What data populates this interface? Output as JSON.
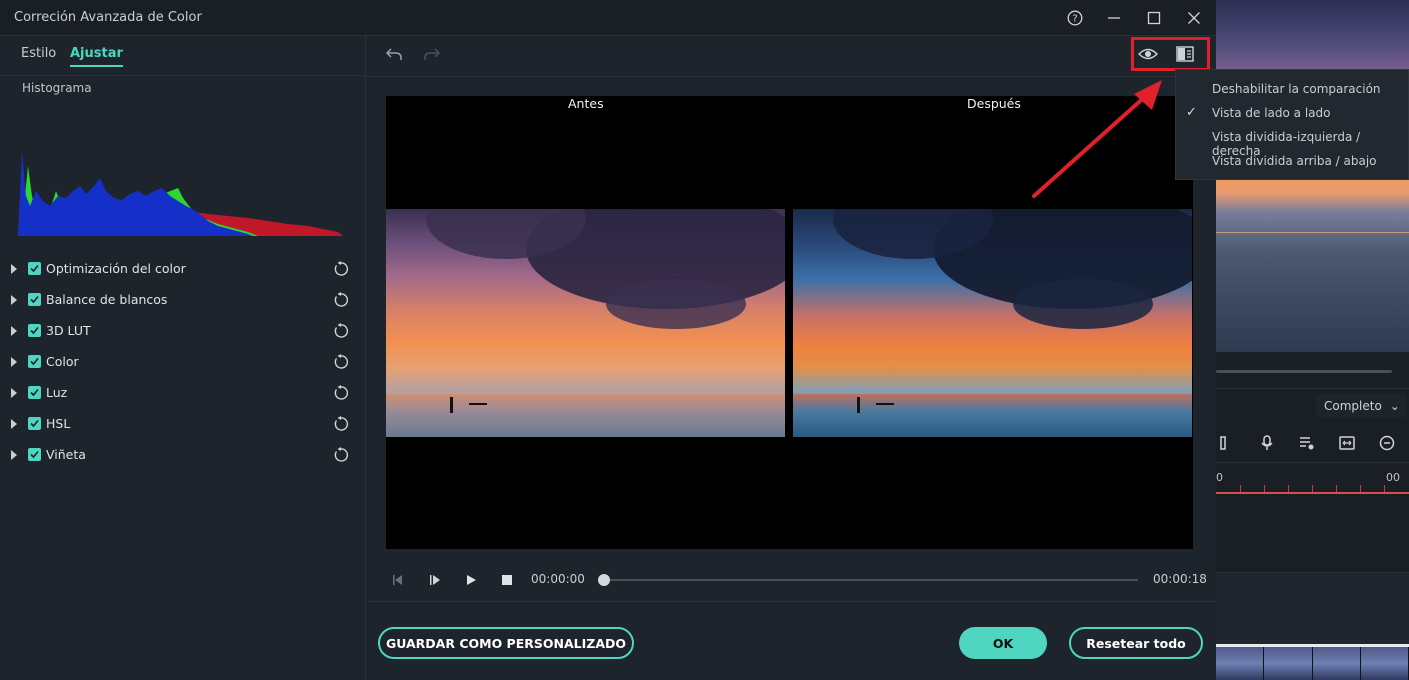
{
  "window": {
    "title": "Correción Avanzada de Color",
    "help_icon": "help-icon",
    "minimize_icon": "minimize-icon",
    "maximize_icon": "maximize-icon",
    "close_icon": "close-icon"
  },
  "tabs": [
    {
      "label": "Estilo",
      "active": false
    },
    {
      "label": "Ajustar",
      "active": true
    }
  ],
  "histogram": {
    "label": "Histograma",
    "colors": {
      "red": "#c0182a",
      "green": "#2fd62f",
      "blue": "#1530c8"
    }
  },
  "adjustments": [
    {
      "label": "Optimización del color",
      "checked": true
    },
    {
      "label": "Balance de blancos",
      "checked": true
    },
    {
      "label": "3D LUT",
      "checked": true
    },
    {
      "label": "Color",
      "checked": true
    },
    {
      "label": "Luz",
      "checked": true
    },
    {
      "label": "HSL",
      "checked": true
    },
    {
      "label": "Viñeta",
      "checked": true
    }
  ],
  "toolbar": {
    "undo_icon": "undo-icon",
    "redo_icon": "redo-icon",
    "eye_icon": "eye-icon",
    "compare_icon": "compare-view-icon"
  },
  "viewer": {
    "before_label": "Antes",
    "after_label": "Después"
  },
  "player": {
    "current_time": "00:00:00",
    "total_time": "00:00:18",
    "progress": 0
  },
  "compare_menu": {
    "items": [
      {
        "label": "Deshabilitar la comparación",
        "selected": false
      },
      {
        "label": "Vista de lado a lado",
        "selected": true
      },
      {
        "label": "Vista dividida-izquierda / derecha",
        "selected": false
      },
      {
        "label": "Vista dividida arriba / abajo",
        "selected": false
      }
    ],
    "check_mark": "✓"
  },
  "buttons": {
    "save_custom": "GUARDAR COMO PERSONALIZADO",
    "ok": "OK",
    "reset_all": "Resetear todo"
  },
  "background_editor": {
    "quality": "Completo",
    "ruler_label_left": "0",
    "ruler_label_right": "00"
  },
  "colors": {
    "accent": "#4fd6c0",
    "annotation": "#e0202a",
    "dialog_bg": "#1e242b"
  }
}
